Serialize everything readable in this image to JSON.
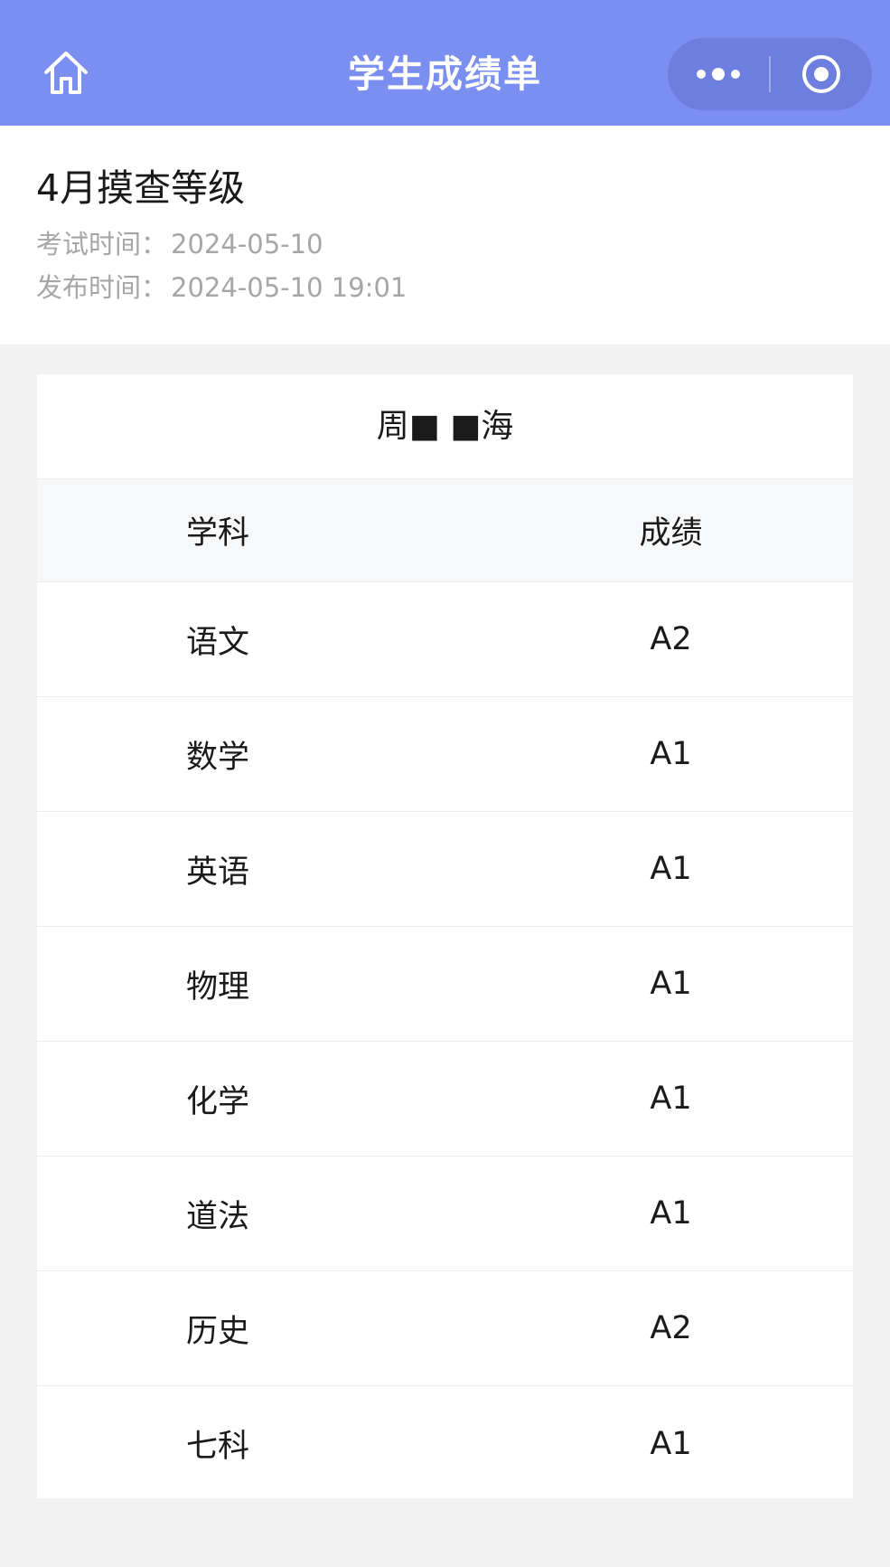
{
  "navbar": {
    "title": "学生成绩单",
    "home_icon": "home-icon",
    "more_icon": "more-dots-icon",
    "close_icon": "target-circle-icon",
    "background_color": "#7b8ff0"
  },
  "exam": {
    "title": "4月摸查等级",
    "exam_time_label": "考试时间：",
    "exam_time_value": "2024-05-10",
    "publish_time_label": "发布时间：",
    "publish_time_value": "2024-05-10 19:01"
  },
  "student": {
    "name": "周■ ■海"
  },
  "table": {
    "headers": {
      "subject": "学科",
      "score": "成绩"
    },
    "rows": [
      {
        "subject": "语文",
        "score": "A2"
      },
      {
        "subject": "数学",
        "score": "A1"
      },
      {
        "subject": "英语",
        "score": "A1"
      },
      {
        "subject": "物理",
        "score": "A1"
      },
      {
        "subject": "化学",
        "score": "A1"
      },
      {
        "subject": "道法",
        "score": "A1"
      },
      {
        "subject": "历史",
        "score": "A2"
      },
      {
        "subject": "七科",
        "score": "A1"
      }
    ]
  }
}
